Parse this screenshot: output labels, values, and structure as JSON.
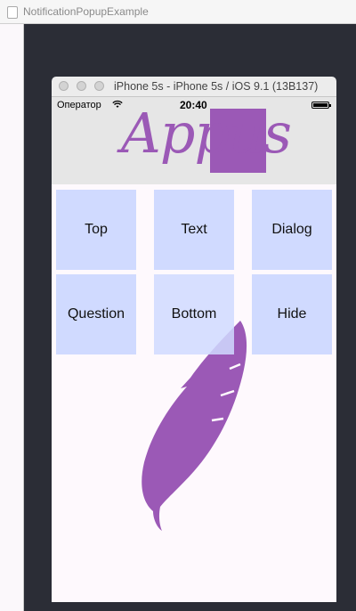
{
  "host": {
    "window_title": "NotificationPopupExample"
  },
  "simulator": {
    "title": "iPhone 5s - iPhone 5s / iOS 9.1 (13B137)"
  },
  "status_bar": {
    "carrier": "Оператор",
    "time": "20:40"
  },
  "app": {
    "logo_text": "Appus",
    "accent_color": "#9b59b6",
    "button_color": "#d0daff",
    "buttons": [
      {
        "label": "Top"
      },
      {
        "label": "Text"
      },
      {
        "label": "Dialog"
      },
      {
        "label": "Question"
      },
      {
        "label": "Bottom"
      },
      {
        "label": "Hide"
      }
    ]
  }
}
